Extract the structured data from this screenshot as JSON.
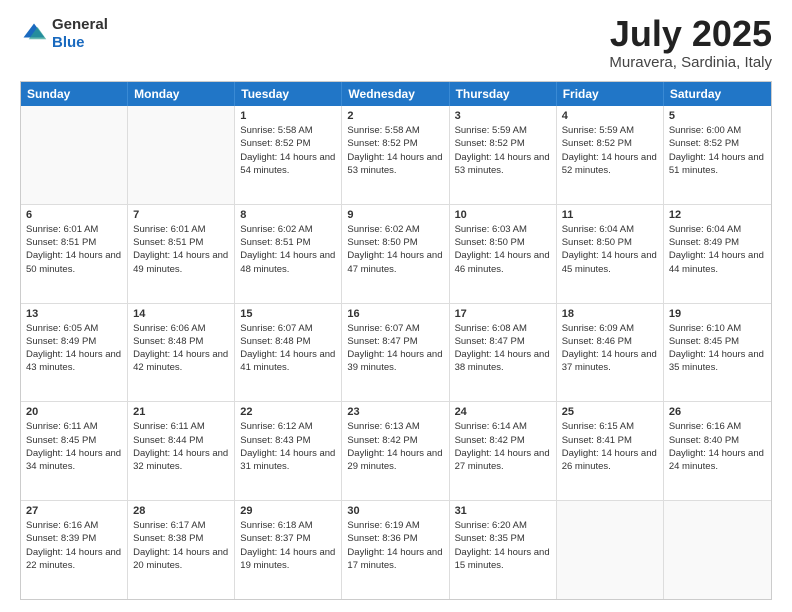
{
  "header": {
    "logo_general": "General",
    "logo_blue": "Blue",
    "month_title": "July 2025",
    "location": "Muravera, Sardinia, Italy"
  },
  "days_of_week": [
    "Sunday",
    "Monday",
    "Tuesday",
    "Wednesday",
    "Thursday",
    "Friday",
    "Saturday"
  ],
  "weeks": [
    [
      {
        "day": "",
        "empty": true
      },
      {
        "day": "",
        "empty": true
      },
      {
        "day": "1",
        "sunrise": "Sunrise: 5:58 AM",
        "sunset": "Sunset: 8:52 PM",
        "daylight": "Daylight: 14 hours and 54 minutes."
      },
      {
        "day": "2",
        "sunrise": "Sunrise: 5:58 AM",
        "sunset": "Sunset: 8:52 PM",
        "daylight": "Daylight: 14 hours and 53 minutes."
      },
      {
        "day": "3",
        "sunrise": "Sunrise: 5:59 AM",
        "sunset": "Sunset: 8:52 PM",
        "daylight": "Daylight: 14 hours and 53 minutes."
      },
      {
        "day": "4",
        "sunrise": "Sunrise: 5:59 AM",
        "sunset": "Sunset: 8:52 PM",
        "daylight": "Daylight: 14 hours and 52 minutes."
      },
      {
        "day": "5",
        "sunrise": "Sunrise: 6:00 AM",
        "sunset": "Sunset: 8:52 PM",
        "daylight": "Daylight: 14 hours and 51 minutes."
      }
    ],
    [
      {
        "day": "6",
        "sunrise": "Sunrise: 6:01 AM",
        "sunset": "Sunset: 8:51 PM",
        "daylight": "Daylight: 14 hours and 50 minutes."
      },
      {
        "day": "7",
        "sunrise": "Sunrise: 6:01 AM",
        "sunset": "Sunset: 8:51 PM",
        "daylight": "Daylight: 14 hours and 49 minutes."
      },
      {
        "day": "8",
        "sunrise": "Sunrise: 6:02 AM",
        "sunset": "Sunset: 8:51 PM",
        "daylight": "Daylight: 14 hours and 48 minutes."
      },
      {
        "day": "9",
        "sunrise": "Sunrise: 6:02 AM",
        "sunset": "Sunset: 8:50 PM",
        "daylight": "Daylight: 14 hours and 47 minutes."
      },
      {
        "day": "10",
        "sunrise": "Sunrise: 6:03 AM",
        "sunset": "Sunset: 8:50 PM",
        "daylight": "Daylight: 14 hours and 46 minutes."
      },
      {
        "day": "11",
        "sunrise": "Sunrise: 6:04 AM",
        "sunset": "Sunset: 8:50 PM",
        "daylight": "Daylight: 14 hours and 45 minutes."
      },
      {
        "day": "12",
        "sunrise": "Sunrise: 6:04 AM",
        "sunset": "Sunset: 8:49 PM",
        "daylight": "Daylight: 14 hours and 44 minutes."
      }
    ],
    [
      {
        "day": "13",
        "sunrise": "Sunrise: 6:05 AM",
        "sunset": "Sunset: 8:49 PM",
        "daylight": "Daylight: 14 hours and 43 minutes."
      },
      {
        "day": "14",
        "sunrise": "Sunrise: 6:06 AM",
        "sunset": "Sunset: 8:48 PM",
        "daylight": "Daylight: 14 hours and 42 minutes."
      },
      {
        "day": "15",
        "sunrise": "Sunrise: 6:07 AM",
        "sunset": "Sunset: 8:48 PM",
        "daylight": "Daylight: 14 hours and 41 minutes."
      },
      {
        "day": "16",
        "sunrise": "Sunrise: 6:07 AM",
        "sunset": "Sunset: 8:47 PM",
        "daylight": "Daylight: 14 hours and 39 minutes."
      },
      {
        "day": "17",
        "sunrise": "Sunrise: 6:08 AM",
        "sunset": "Sunset: 8:47 PM",
        "daylight": "Daylight: 14 hours and 38 minutes."
      },
      {
        "day": "18",
        "sunrise": "Sunrise: 6:09 AM",
        "sunset": "Sunset: 8:46 PM",
        "daylight": "Daylight: 14 hours and 37 minutes."
      },
      {
        "day": "19",
        "sunrise": "Sunrise: 6:10 AM",
        "sunset": "Sunset: 8:45 PM",
        "daylight": "Daylight: 14 hours and 35 minutes."
      }
    ],
    [
      {
        "day": "20",
        "sunrise": "Sunrise: 6:11 AM",
        "sunset": "Sunset: 8:45 PM",
        "daylight": "Daylight: 14 hours and 34 minutes."
      },
      {
        "day": "21",
        "sunrise": "Sunrise: 6:11 AM",
        "sunset": "Sunset: 8:44 PM",
        "daylight": "Daylight: 14 hours and 32 minutes."
      },
      {
        "day": "22",
        "sunrise": "Sunrise: 6:12 AM",
        "sunset": "Sunset: 8:43 PM",
        "daylight": "Daylight: 14 hours and 31 minutes."
      },
      {
        "day": "23",
        "sunrise": "Sunrise: 6:13 AM",
        "sunset": "Sunset: 8:42 PM",
        "daylight": "Daylight: 14 hours and 29 minutes."
      },
      {
        "day": "24",
        "sunrise": "Sunrise: 6:14 AM",
        "sunset": "Sunset: 8:42 PM",
        "daylight": "Daylight: 14 hours and 27 minutes."
      },
      {
        "day": "25",
        "sunrise": "Sunrise: 6:15 AM",
        "sunset": "Sunset: 8:41 PM",
        "daylight": "Daylight: 14 hours and 26 minutes."
      },
      {
        "day": "26",
        "sunrise": "Sunrise: 6:16 AM",
        "sunset": "Sunset: 8:40 PM",
        "daylight": "Daylight: 14 hours and 24 minutes."
      }
    ],
    [
      {
        "day": "27",
        "sunrise": "Sunrise: 6:16 AM",
        "sunset": "Sunset: 8:39 PM",
        "daylight": "Daylight: 14 hours and 22 minutes."
      },
      {
        "day": "28",
        "sunrise": "Sunrise: 6:17 AM",
        "sunset": "Sunset: 8:38 PM",
        "daylight": "Daylight: 14 hours and 20 minutes."
      },
      {
        "day": "29",
        "sunrise": "Sunrise: 6:18 AM",
        "sunset": "Sunset: 8:37 PM",
        "daylight": "Daylight: 14 hours and 19 minutes."
      },
      {
        "day": "30",
        "sunrise": "Sunrise: 6:19 AM",
        "sunset": "Sunset: 8:36 PM",
        "daylight": "Daylight: 14 hours and 17 minutes."
      },
      {
        "day": "31",
        "sunrise": "Sunrise: 6:20 AM",
        "sunset": "Sunset: 8:35 PM",
        "daylight": "Daylight: 14 hours and 15 minutes."
      },
      {
        "day": "",
        "empty": true
      },
      {
        "day": "",
        "empty": true
      }
    ]
  ]
}
